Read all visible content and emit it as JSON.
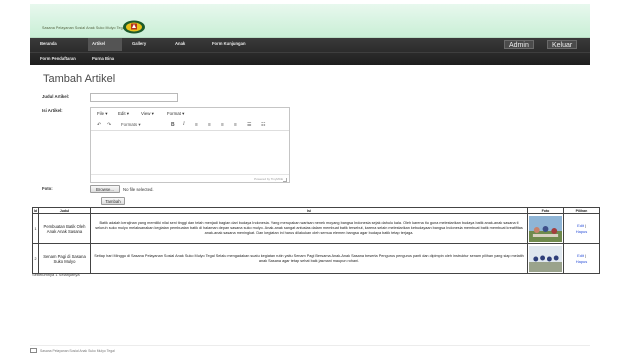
{
  "header": {
    "brand": "Sasana Pelayanan Sosial Anak Suko Mulyo Tegal",
    "logo_icon": "regional-crest-logo"
  },
  "nav": {
    "items": [
      "Beranda",
      "Artikel",
      "Gallery",
      "Anak",
      "Form Kunjungan"
    ],
    "items_row2": [
      "Form Pendaftaran",
      "Purna Bina"
    ],
    "active": "Artikel",
    "admin_label": "Admin",
    "logout_label": "Keluar"
  },
  "form": {
    "title": "Tambah Artikel",
    "judul_label": "Judul Artikel:",
    "judul_value": "",
    "isi_label": "Isi Artikel:",
    "foto_label": "Foto:",
    "browse_label": "Browse...",
    "no_file_text": "No file selected.",
    "submit_label": "Tambah"
  },
  "editor": {
    "menus": [
      "File ▾",
      "Edit ▾",
      "View ▾",
      "Format ▾"
    ],
    "formats_label": "Formats ▾",
    "bold": "B",
    "italic": "I",
    "undo_icon": "undo-icon",
    "redo_icon": "redo-icon",
    "status": "Powered by TinyMCE"
  },
  "table": {
    "headers": [
      "Id",
      "Judul",
      "Isi",
      "Foto",
      "Pilihan"
    ],
    "rows": [
      {
        "id": "1",
        "judul": "Pembuatan Batik Oleh Anak Anak Sasana",
        "isi": "Batik adalah kerajinan yang memiliki nilai seni tinggi dan telah menjadi bagian dari budaya Indonesia. Yang merupakan warisan nenek moyang bangsa Indonesia sejak dahulu kala. Oleh karena itu guna melestarikan budaya batik anak-anak sasana ti seluruh suko mulyo melaksanakan kegiatan pembuatan batik di halaman depan sasana suko mulyo. Anak-anak sangat antusias dalam membuat batik tersebut, karena selain melestarikan kebudayaan bangsa Indonesia membuat batik membuat kreatifitas anak-anak sasana meningkat. Dan kegiatan ini harus dilakukan oleh semua elemen bangsa agar budaya batik tetap terjaga.",
        "edit": "Edit",
        "hapus": "Hapus"
      },
      {
        "id": "2",
        "judul": "Senam Pagi di Sasana Suko Mulyo",
        "isi": "Setiap hari Minggu di Sasana Pelayanan Sosial Anak Suko Mulyo Tegal Selalu mengadakan suatu kegiatan rutin yaitu Senam Pagi Bersama Anak-Anak Sasana beserta Pengurus pengurus panti dan dipimpin oleh instruktur senam pilihan yang siap melatih anak Sasana agar tetap sehat baik jasmani maupun rohani.",
        "edit": "Edit",
        "hapus": "Hapus"
      }
    ]
  },
  "pager": "Sebelumnya 1 Selanjutnya",
  "footer": "Sasana Pelayanan Sosial Anak Suko Mulyo Tegal",
  "colors": {
    "header_green": "#c9efd6",
    "nav_dark": "#2a2a2a",
    "link_blue": "#2a4fd8"
  }
}
